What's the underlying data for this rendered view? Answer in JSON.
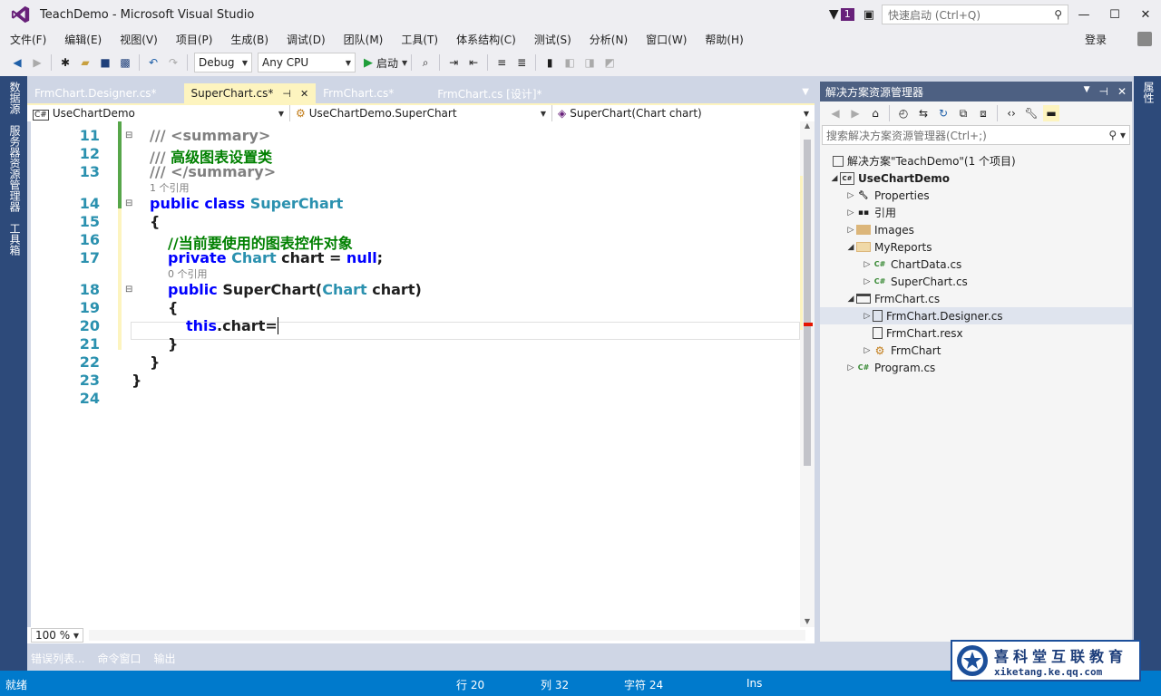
{
  "window": {
    "title": "TeachDemo - Microsoft Visual Studio",
    "notification_count": "1"
  },
  "quick_launch": {
    "placeholder": "快速启动 (Ctrl+Q)"
  },
  "menu": [
    "文件(F)",
    "编辑(E)",
    "视图(V)",
    "项目(P)",
    "生成(B)",
    "调试(D)",
    "团队(M)",
    "工具(T)",
    "体系结构(C)",
    "测试(S)",
    "分析(N)",
    "窗口(W)",
    "帮助(H)"
  ],
  "login": "登录",
  "toolbar": {
    "config": "Debug",
    "platform": "Any CPU",
    "start": "启动"
  },
  "left_strip": [
    "数据源",
    "服务器资源管理器",
    "工具箱"
  ],
  "right_strip": [
    "属性"
  ],
  "editor": {
    "tabs": [
      {
        "label": "FrmChart.Designer.cs*",
        "active": false
      },
      {
        "label": "SuperChart.cs*",
        "active": true
      },
      {
        "label": "FrmChart.cs*",
        "active": false
      },
      {
        "label": "FrmChart.cs [设计]*",
        "active": false
      }
    ],
    "nav": {
      "project": "UseChartDemo",
      "type": "UseChartDemo.SuperChart",
      "member": "SuperChart(Chart chart)"
    },
    "line_numbers": [
      "11",
      "12",
      "13",
      "14",
      "15",
      "16",
      "17",
      "18",
      "19",
      "20",
      "21",
      "22",
      "23",
      "24"
    ],
    "lines": {
      "l11a": "/// ",
      "l11b": "<summary>",
      "l12a": "/// ",
      "l12b": "高级图表设置类",
      "l13a": "/// ",
      "l13b": "</summary>",
      "lens1": "1 个引用",
      "l14a": "public class ",
      "l14b": "SuperChart",
      "l15": "{",
      "l16": "//当前要使用的图表控件对象",
      "l17a": "private ",
      "l17b": "Chart",
      "l17c": " chart = ",
      "l17d": "null",
      "l17e": ";",
      "lens2": "0 个引用",
      "l18a": "public ",
      "l18b": "SuperChart(",
      "l18c": "Chart",
      "l18d": " chart)",
      "l19": "{",
      "l20a": "this",
      "l20b": ".chart=",
      "l21": "}",
      "l22": "}",
      "l23": "}"
    },
    "zoom": "100 %"
  },
  "bottom_tabs": [
    "错误列表...",
    "命令窗口",
    "输出"
  ],
  "solution_explorer": {
    "title": "解决方案资源管理器",
    "search_placeholder": "搜索解决方案资源管理器(Ctrl+;)",
    "items": [
      {
        "label": "解决方案\"TeachDemo\"(1 个项目)",
        "icon": "solution-icon",
        "bold": false
      },
      {
        "label": "UseChartDemo",
        "icon": "csharp-project-icon",
        "bold": true
      },
      {
        "label": "Properties",
        "icon": "wrench-icon"
      },
      {
        "label": "引用",
        "icon": "references-icon"
      },
      {
        "label": "Images",
        "icon": "folder-icon"
      },
      {
        "label": "MyReports",
        "icon": "folder-open-icon"
      },
      {
        "label": "ChartData.cs",
        "icon": "csharp-file-icon"
      },
      {
        "label": "SuperChart.cs",
        "icon": "csharp-file-icon"
      },
      {
        "label": "FrmChart.cs",
        "icon": "form-icon"
      },
      {
        "label": "FrmChart.Designer.cs",
        "icon": "document-icon"
      },
      {
        "label": "FrmChart.resx",
        "icon": "document-icon"
      },
      {
        "label": "FrmChart",
        "icon": "class-icon"
      },
      {
        "label": "Program.cs",
        "icon": "csharp-file-icon"
      }
    ]
  },
  "status": {
    "ready": "就绪",
    "line": "行 20",
    "col": "列 32",
    "char": "字符 24",
    "mode": "Ins"
  },
  "watermark": {
    "name": "喜科堂互联教育",
    "url": "xiketang.ke.qq.com"
  },
  "colors": {
    "accent": "#007acc",
    "keyword": "#0000ff",
    "type": "#2b91af",
    "comment": "#008000",
    "tab_active": "#fdf4bf"
  }
}
